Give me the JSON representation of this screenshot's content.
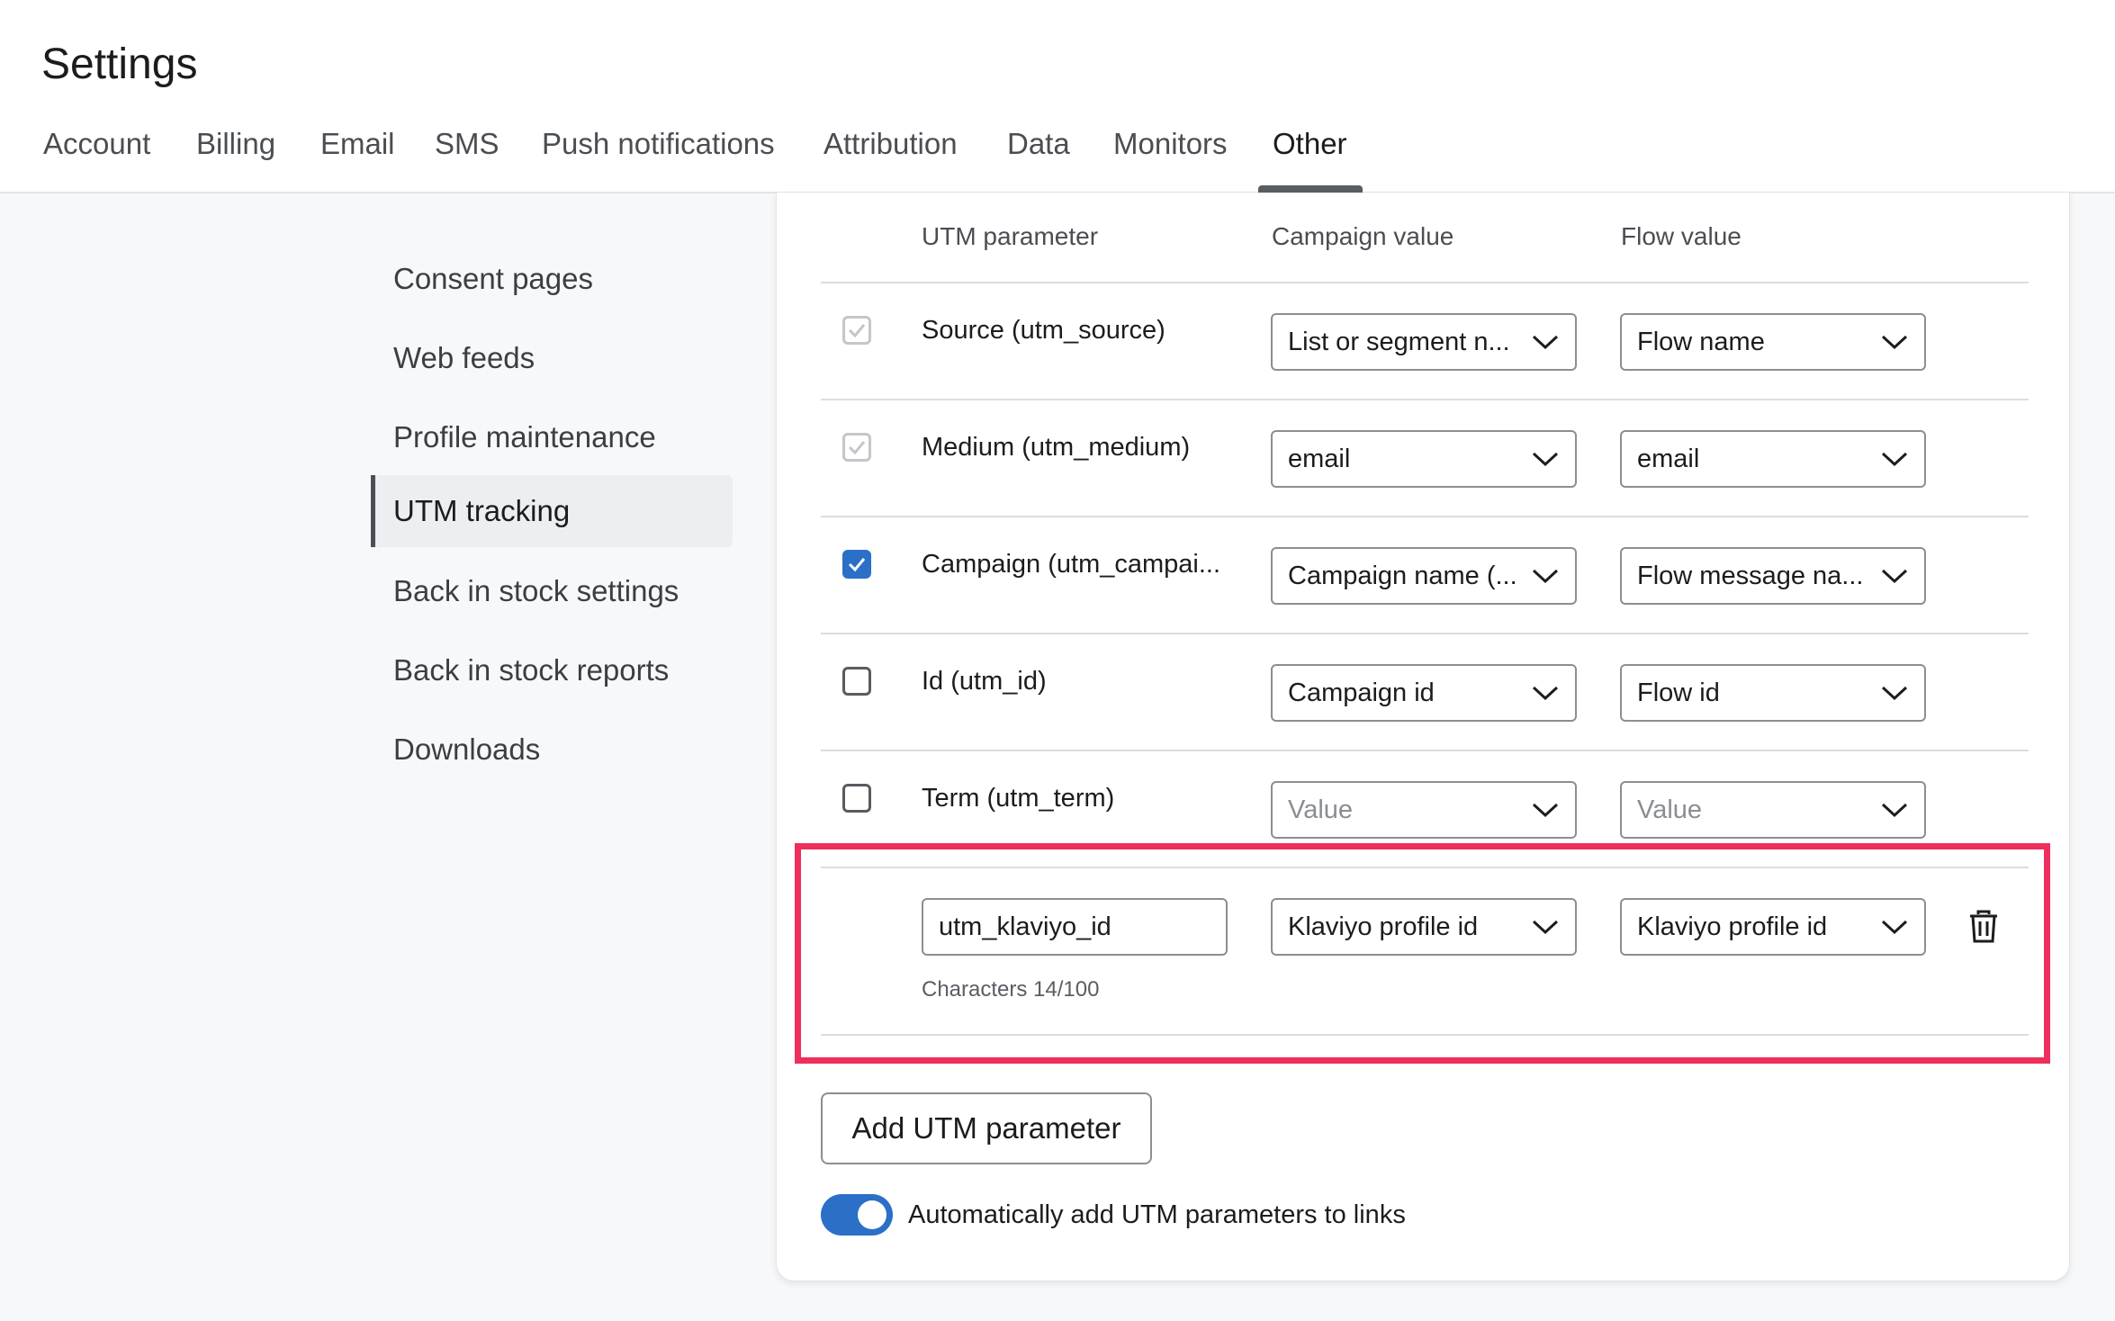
{
  "header": {
    "title": "Settings",
    "tabs": [
      {
        "label": "Account"
      },
      {
        "label": "Billing"
      },
      {
        "label": "Email"
      },
      {
        "label": "SMS"
      },
      {
        "label": "Push notifications"
      },
      {
        "label": "Attribution"
      },
      {
        "label": "Data"
      },
      {
        "label": "Monitors"
      },
      {
        "label": "Other"
      }
    ],
    "active_tab": "Other"
  },
  "sidebar": {
    "items": [
      {
        "label": "Consent pages"
      },
      {
        "label": "Web feeds"
      },
      {
        "label": "Profile maintenance"
      },
      {
        "label": "UTM tracking"
      },
      {
        "label": "Back in stock settings"
      },
      {
        "label": "Back in stock reports"
      },
      {
        "label": "Downloads"
      }
    ],
    "active_item": "UTM tracking"
  },
  "table": {
    "headers": {
      "parameter": "UTM parameter",
      "campaign": "Campaign value",
      "flow": "Flow value"
    },
    "rows": [
      {
        "label": "Source (utm_source)",
        "checked": true,
        "disabled": true,
        "campaign_value": "List or segment n...",
        "flow_value": "Flow name"
      },
      {
        "label": "Medium (utm_medium)",
        "checked": true,
        "disabled": true,
        "campaign_value": "email",
        "flow_value": "email"
      },
      {
        "label": "Campaign (utm_campai...",
        "checked": true,
        "disabled": false,
        "campaign_value": "Campaign name (...",
        "flow_value": "Flow message na..."
      },
      {
        "label": "Id (utm_id)",
        "checked": false,
        "disabled": false,
        "campaign_value": "Campaign id",
        "flow_value": "Flow id"
      },
      {
        "label": "Term (utm_term)",
        "checked": false,
        "disabled": false,
        "campaign_placeholder": "Value",
        "flow_placeholder": "Value"
      }
    ],
    "custom_row": {
      "name_value": "utm_klaviyo_id",
      "char_count": "Characters 14/100",
      "campaign_value": "Klaviyo profile id",
      "flow_value": "Klaviyo profile id"
    }
  },
  "actions": {
    "add_label": "Add UTM parameter"
  },
  "auto_toggle": {
    "label": "Automatically add UTM parameters to links",
    "on": true
  },
  "colors": {
    "accent": "#2b6fc7",
    "highlight": "#ee2f5c"
  }
}
